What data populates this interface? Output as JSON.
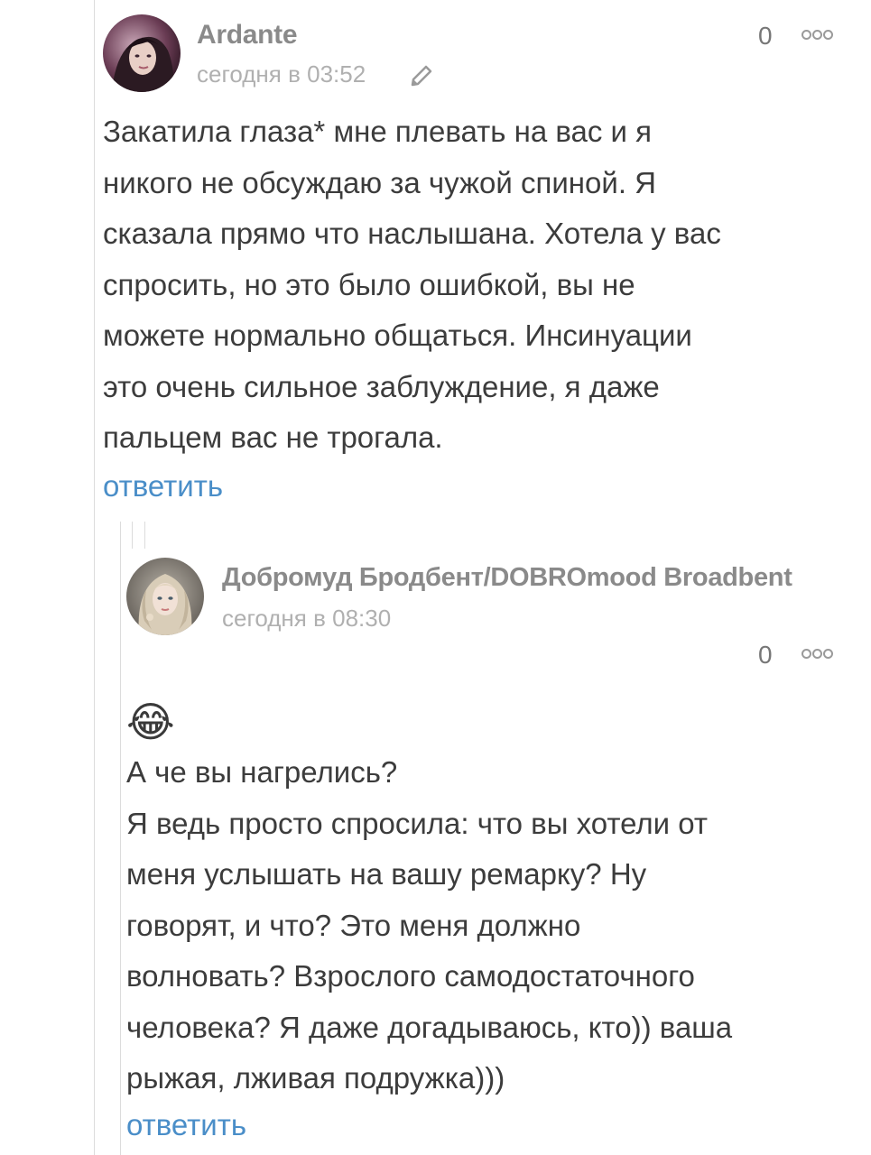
{
  "comments": [
    {
      "author": "Ardante",
      "timestamp": "сегодня в 03:52",
      "rating": "0",
      "edited_icon": "pencil-icon",
      "more_icon": "more-options-icon",
      "text_lines": [
        "Закатила глаза* мне плевать на вас и я",
        "никого не обсуждаю за чужой спиной. Я",
        "сказала прямо что наслышана. Хотела у вас",
        "спросить, но это было ошибкой, вы не",
        "можете нормально общаться. Инсинуации",
        "это очень сильное заблуждение, я даже",
        "пальцем вас не трогала."
      ],
      "reply_label": "ответить"
    },
    {
      "author": "Добромуд Бродбент/DOBROmood Broadbent",
      "timestamp": "сегодня в 08:30",
      "rating": "0",
      "more_icon": "more-options-icon",
      "emoji": "😂",
      "text_lines": [
        "А че вы нагрелись?",
        "Я ведь просто спросила: что вы хотели от",
        "меня услышать на вашу ремарку? Ну",
        "говорят, и что? Это меня должно",
        "волновать? Взрослого самодостаточного",
        "человека? Я даже догадываюсь, кто)) ваша",
        "рыжая, лживая подружка)))"
      ],
      "reply_label": "ответить"
    }
  ],
  "colors": {
    "author": "#8a8a8a",
    "meta": "#b0b0b0",
    "text": "#3c3c3c",
    "reply_link": "#4a8ec8",
    "thread_line": "#dcdcdc"
  }
}
